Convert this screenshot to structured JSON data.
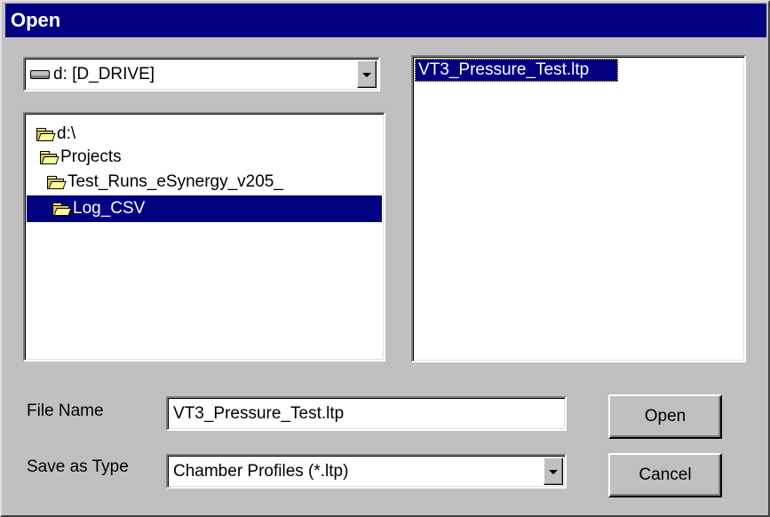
{
  "window": {
    "title": "Open"
  },
  "drive_combo": {
    "value": "d: [D_DRIVE]",
    "icon": "drive-icon"
  },
  "folder_tree": {
    "items": [
      {
        "label": "d:\\",
        "icon": "open-folder-icon",
        "selected": false
      },
      {
        "label": "Projects",
        "icon": "open-folder-icon",
        "selected": false
      },
      {
        "label": "Test_Runs_eSynergy_v205_",
        "icon": "open-folder-icon",
        "selected": false
      },
      {
        "label": "Log_CSV",
        "icon": "open-folder-icon",
        "selected": true
      }
    ]
  },
  "file_list": {
    "items": [
      {
        "label": "VT3_Pressure_Test.ltp",
        "selected": true
      }
    ]
  },
  "form": {
    "file_name_label": "File Name",
    "file_name_value": "VT3_Pressure_Test.ltp",
    "save_type_label": "Save as Type",
    "save_type_value": "Chamber Profiles (*.ltp)"
  },
  "buttons": {
    "open_label": "Open",
    "cancel_label": "Cancel"
  },
  "colors": {
    "title_bar": "#000080",
    "face": "#c0c0c0",
    "selection": "#000080"
  }
}
